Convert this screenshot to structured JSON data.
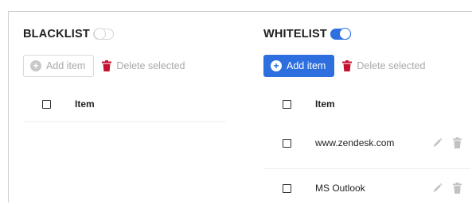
{
  "blacklist": {
    "title": "BLACKLIST",
    "toggle_state": "off",
    "add_label": "Add item",
    "delete_label": "Delete selected",
    "column_header": "Item",
    "items": []
  },
  "whitelist": {
    "title": "WHITELIST",
    "toggle_state": "on",
    "add_label": "Add item",
    "delete_label": "Delete selected",
    "column_header": "Item",
    "items": [
      {
        "label": "www.zendesk.com"
      },
      {
        "label": "MS Outlook"
      }
    ]
  },
  "colors": {
    "primary": "#2e6fe0",
    "danger": "#c4112f",
    "muted_text": "#a9a9a9",
    "icon_gray": "#c2c2c2"
  }
}
